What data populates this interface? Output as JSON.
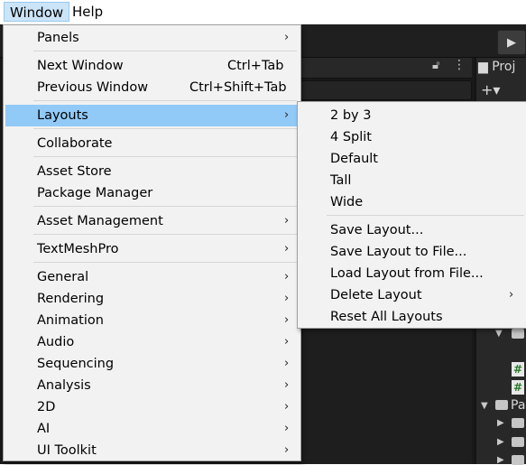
{
  "menubar": {
    "items": [
      {
        "label": "Window",
        "active": true
      },
      {
        "label": "Help",
        "active": false
      }
    ]
  },
  "window_menu": {
    "items": [
      {
        "label": "Panels",
        "shortcut": "",
        "submenu": true
      },
      {
        "label": "Next Window",
        "shortcut": "Ctrl+Tab",
        "submenu": false
      },
      {
        "label": "Previous Window",
        "shortcut": "Ctrl+Shift+Tab",
        "submenu": false
      },
      {
        "label": "Layouts",
        "shortcut": "",
        "submenu": true,
        "highlighted": true
      },
      {
        "label": "Collaborate",
        "shortcut": "",
        "submenu": false
      },
      {
        "label": "Asset Store",
        "shortcut": "",
        "submenu": false
      },
      {
        "label": "Package Manager",
        "shortcut": "",
        "submenu": false
      },
      {
        "label": "Asset Management",
        "shortcut": "",
        "submenu": true
      },
      {
        "label": "TextMeshPro",
        "shortcut": "",
        "submenu": true
      },
      {
        "label": "General",
        "shortcut": "",
        "submenu": true
      },
      {
        "label": "Rendering",
        "shortcut": "",
        "submenu": true
      },
      {
        "label": "Animation",
        "shortcut": "",
        "submenu": true
      },
      {
        "label": "Audio",
        "shortcut": "",
        "submenu": true
      },
      {
        "label": "Sequencing",
        "shortcut": "",
        "submenu": true
      },
      {
        "label": "Analysis",
        "shortcut": "",
        "submenu": true
      },
      {
        "label": "2D",
        "shortcut": "",
        "submenu": true
      },
      {
        "label": "AI",
        "shortcut": "",
        "submenu": true
      },
      {
        "label": "UI Toolkit",
        "shortcut": "",
        "submenu": true
      }
    ]
  },
  "layouts_menu": {
    "items": [
      {
        "label": "2 by 3",
        "submenu": false
      },
      {
        "label": "4 Split",
        "submenu": false
      },
      {
        "label": "Default",
        "submenu": false
      },
      {
        "label": "Tall",
        "submenu": false
      },
      {
        "label": "Wide",
        "submenu": false
      },
      {
        "label": "Save Layout...",
        "submenu": false
      },
      {
        "label": "Save Layout to File...",
        "submenu": false
      },
      {
        "label": "Load Layout from File...",
        "submenu": false
      },
      {
        "label": "Delete Layout",
        "submenu": true
      },
      {
        "label": "Reset All Layouts",
        "submenu": false
      }
    ]
  },
  "background": {
    "project_tab_label": "Proj",
    "folder_label": "Pa",
    "colors": {
      "menu_bg": "#f2f2f2",
      "highlight": "#91c9f7",
      "editor_bg": "#191919",
      "menubar_active": "#cce4f7"
    }
  }
}
